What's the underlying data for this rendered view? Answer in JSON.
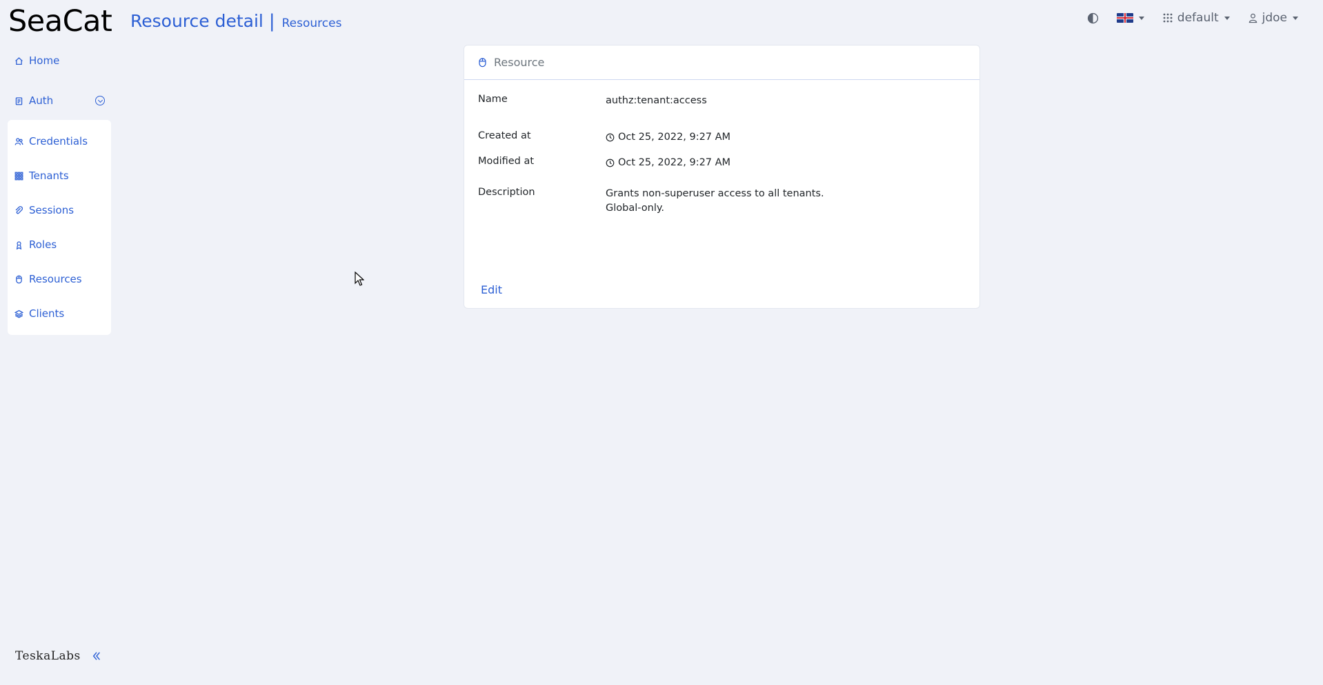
{
  "app": {
    "brand": "SeaCat"
  },
  "header": {
    "title": "Resource detail",
    "separator": "|",
    "breadcrumb": "Resources",
    "tenant": "default",
    "user": "jdoe",
    "theme_icon": "contrast-icon",
    "language_icon": "uk-flag-icon"
  },
  "sidebar": {
    "home": {
      "label": "Home",
      "icon": "house-icon"
    },
    "auth": {
      "label": "Auth",
      "icon": "clipboard-icon"
    },
    "items": [
      {
        "label": "Credentials",
        "icon": "people-icon"
      },
      {
        "label": "Tenants",
        "icon": "grid-icon"
      },
      {
        "label": "Sessions",
        "icon": "paperclip-icon"
      },
      {
        "label": "Roles",
        "icon": "person-badge-icon"
      },
      {
        "label": "Resources",
        "icon": "mouse-icon"
      },
      {
        "label": "Clients",
        "icon": "layers-icon"
      }
    ],
    "footer_logo": "TeskaLabs"
  },
  "card": {
    "title": "Resource",
    "fields": {
      "name_label": "Name",
      "name_value": "authz:tenant:access",
      "created_label": "Created at",
      "created_value": "Oct 25, 2022, 9:27 AM",
      "modified_label": "Modified at",
      "modified_value": "Oct 25, 2022, 9:27 AM",
      "description_label": "Description",
      "description_value": "Grants non-superuser access to all tenants. Global-only."
    },
    "edit_label": "Edit"
  },
  "colors": {
    "accent": "#2c5fd4",
    "background": "#f0f2f8",
    "card": "#ffffff"
  }
}
